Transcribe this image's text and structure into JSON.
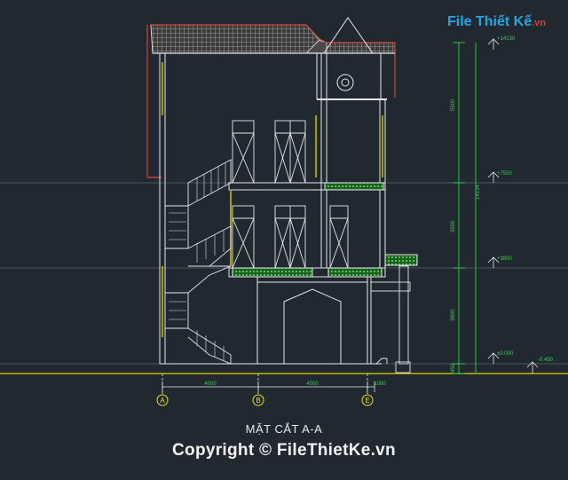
{
  "title": "MẶT CẮT A-A",
  "watermark": "Copyright © FileThietKe.vn",
  "logo": {
    "main": "File Thiết Kế",
    "suffix": ".vn"
  },
  "grid_axes": [
    {
      "label": "A"
    },
    {
      "label": "B"
    },
    {
      "label": "E"
    }
  ],
  "dimensions_bottom": [
    "4000",
    "4500",
    "1090"
  ],
  "dimensions_right": [
    "14134",
    "5500",
    "3550",
    "3800",
    "450"
  ],
  "level_marks": [
    "+14130",
    "+7500",
    "+3800",
    "±0.000",
    "-0.450"
  ],
  "colors": {
    "background": "#212830",
    "lines": "#e6e6e6",
    "dimension": "#2fd24a",
    "roof_outline": "#d1473a",
    "structure_yellow": "#d8d400",
    "axis": "#e8e020"
  }
}
